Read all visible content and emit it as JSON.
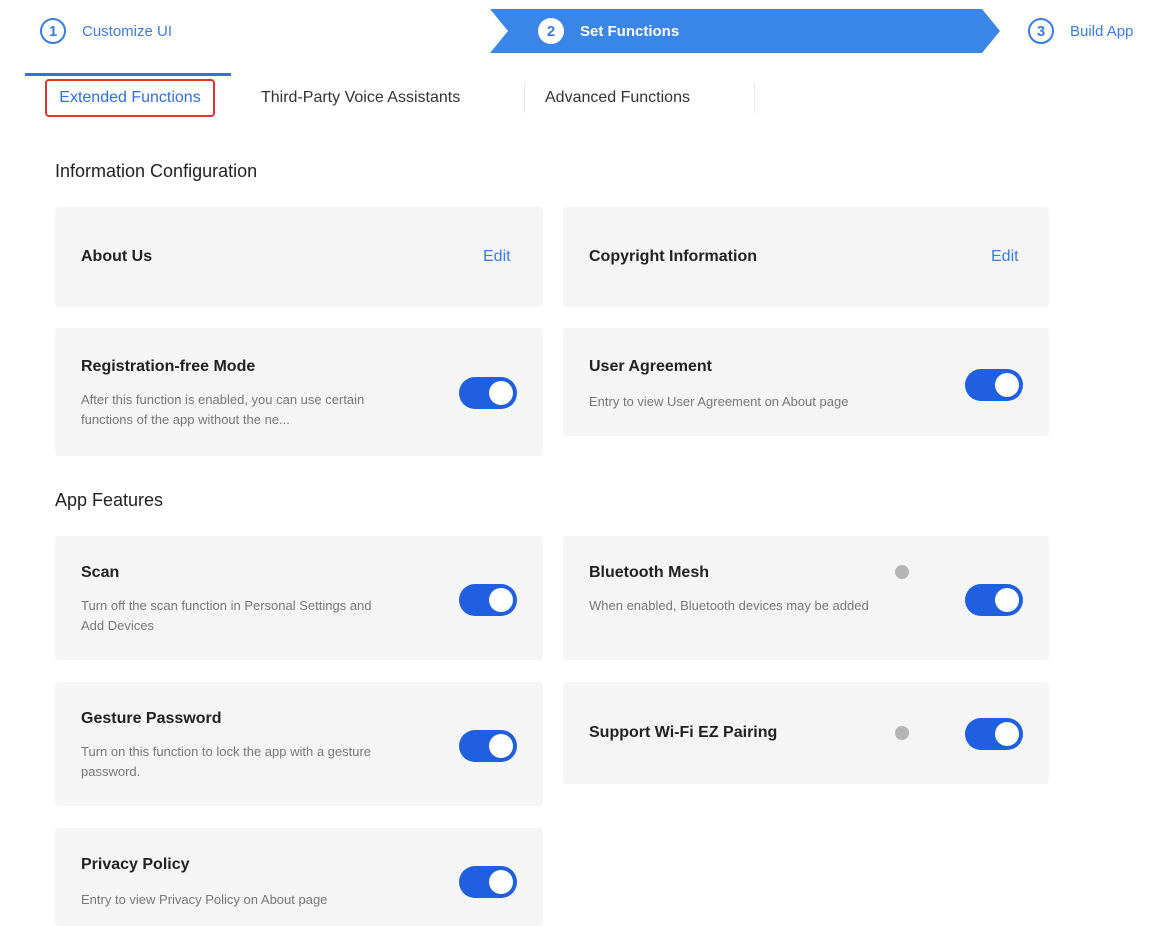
{
  "stepper": {
    "steps": [
      {
        "num": "1",
        "label": "Customize UI"
      },
      {
        "num": "2",
        "label": "Set Functions"
      },
      {
        "num": "3",
        "label": "Build App"
      }
    ]
  },
  "tabs": [
    {
      "label": "Extended Functions"
    },
    {
      "label": "Third-Party Voice Assistants"
    },
    {
      "label": "Advanced Functions"
    }
  ],
  "info_config": {
    "title": "Information Configuration",
    "about_us": {
      "title": "About Us",
      "action": "Edit"
    },
    "copyright": {
      "title": "Copyright Information",
      "action": "Edit"
    },
    "registration_free": {
      "title": "Registration-free Mode",
      "desc": "After this function is enabled, you can use certain functions of the app without the ne...",
      "enabled": true
    },
    "user_agreement": {
      "title": "User Agreement",
      "desc": "Entry to view User Agreement on About page",
      "enabled": true
    }
  },
  "app_features": {
    "title": "App Features",
    "scan": {
      "title": "Scan",
      "desc": "Turn off the scan function in Personal Settings and Add Devices",
      "enabled": true
    },
    "bluetooth_mesh": {
      "title": "Bluetooth Mesh",
      "desc": "When enabled, Bluetooth devices may be added",
      "enabled": true
    },
    "gesture_password": {
      "title": "Gesture Password",
      "desc": "Turn on this function to lock the app with a gesture password.",
      "enabled": true
    },
    "wifi_ez": {
      "title": "Support Wi-Fi EZ Pairing",
      "enabled": true
    },
    "privacy_policy": {
      "title": "Privacy Policy",
      "desc": "Entry to view Privacy Policy on About page",
      "enabled": true
    }
  },
  "colors": {
    "accent": "#1f5fe0",
    "link": "#3a7be8",
    "card_bg": "#f5f5f5",
    "tab_highlight": "#e0342f"
  }
}
